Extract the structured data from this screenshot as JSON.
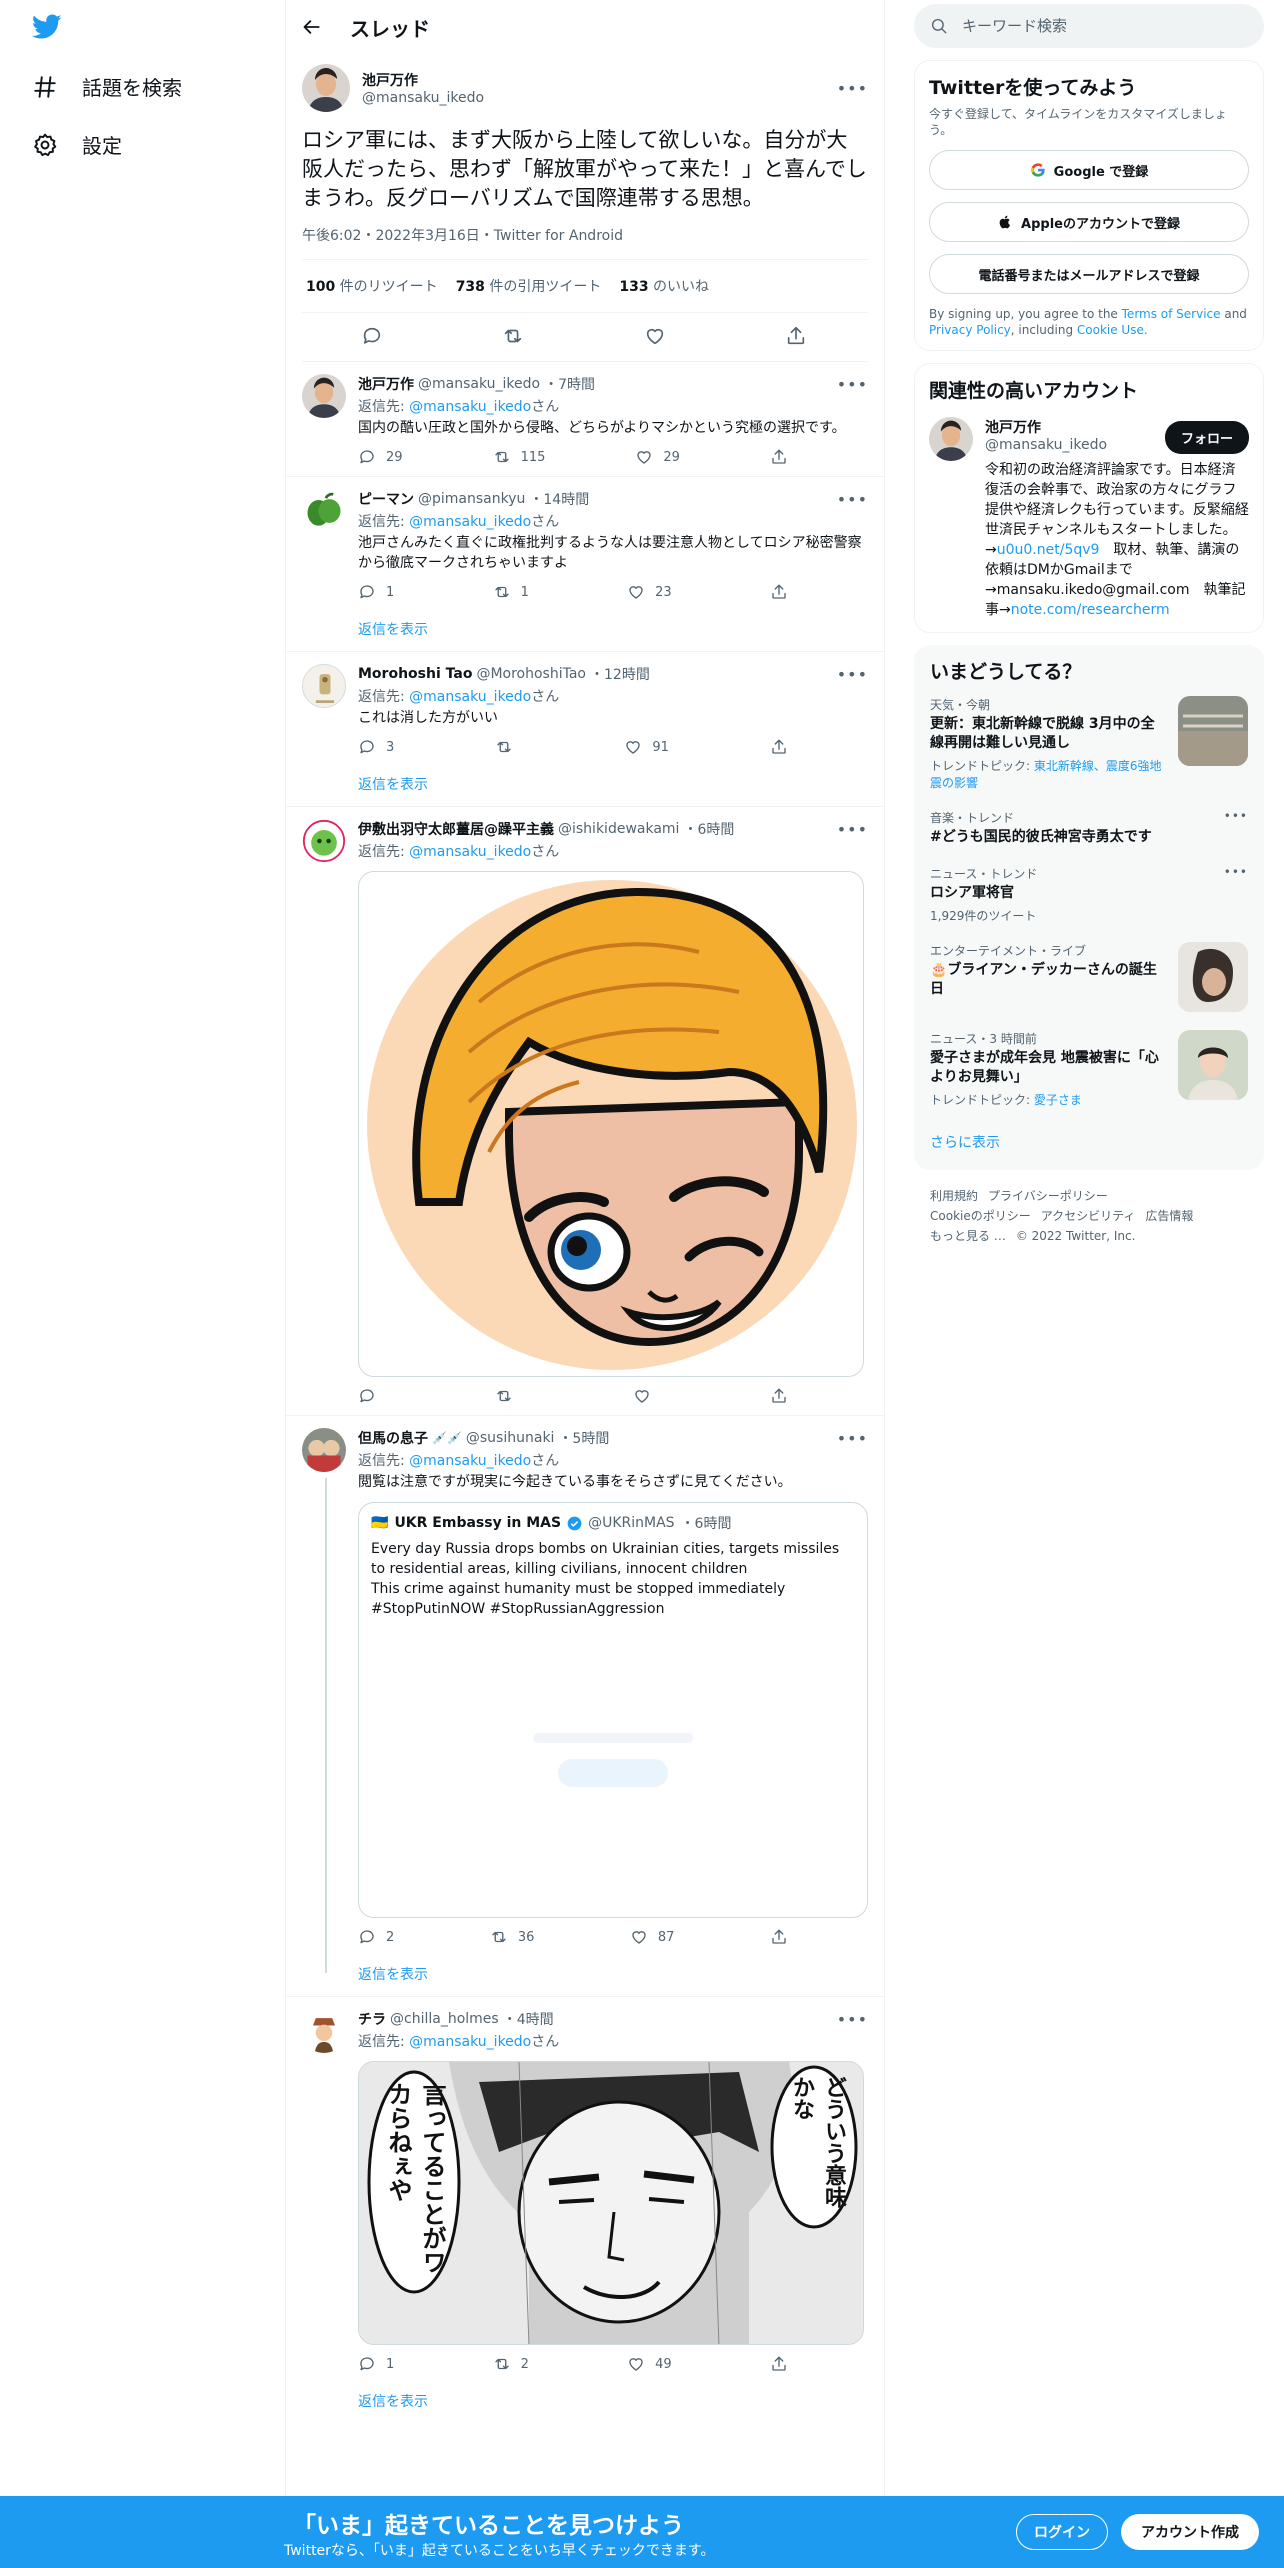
{
  "nav": {
    "explore_label": "話題を検索",
    "settings_label": "設定"
  },
  "header": {
    "title": "スレッド"
  },
  "focus_tweet": {
    "name": "池戸万作",
    "handle": "@mansaku_ikedo",
    "text": "ロシア軍には、まず大阪から上陸して欲しいな。自分が大阪人だったら、思わず「解放軍がやって来た！」と喜んでしまうわ。反グローバリズムで国際連帯する思想。",
    "meta": "午後6:02・2022年3月16日・Twitter for Android",
    "retweets_num": "100",
    "retweets_label": " 件のリツイート",
    "quotes_num": "738",
    "quotes_label": " 件の引用ツイート",
    "likes_num": "133",
    "likes_label": " のいいね"
  },
  "reply_to_prefix": "返信先: ",
  "reply_to_handle": "@mansaku_ikedo",
  "reply_to_suffix": "さん",
  "show_replies": "返信を表示",
  "replies": [
    {
      "name": "池戸万作",
      "handle": "@mansaku_ikedo",
      "time": "・7時間",
      "text": "国内の酷い圧政と国外から侵略、どちらがよりマシかという究極の選択です。",
      "replies": "29",
      "retweets": "115",
      "likes": "29"
    },
    {
      "name": "ピーマン",
      "handle": "@pimansankyu",
      "time": "・14時間",
      "text": "池戸さんみたく直ぐに政権批判するような人は要注意人物としてロシア秘密警察から徹底マークされちゃいますよ",
      "replies": "1",
      "retweets": "1",
      "likes": "23"
    },
    {
      "name": "Morohoshi Tao",
      "handle": "@MorohoshiTao",
      "time": "・12時間",
      "text": "これは消した方がいい",
      "replies": "3",
      "retweets": "",
      "likes": "91"
    },
    {
      "name": "伊敷出羽守太郎薑居@躁平主義",
      "handle": "@ishikidewakami",
      "time": "・6時間"
    },
    {
      "name": "但馬の息子",
      "name_emoji": "💉💉",
      "handle": "@susihunaki",
      "time": "・5時間",
      "text": "閲覧は注意ですが現実に今起きている事をそらさずに見てください。",
      "replies": "2",
      "retweets": "36",
      "likes": "87"
    },
    {
      "name": "チラ",
      "handle": "@chilla_holmes",
      "time": "・4時間",
      "replies": "1",
      "retweets": "2",
      "likes": "49"
    }
  ],
  "quote": {
    "flag": "🇺🇦",
    "name": "UKR Embassy in MAS",
    "handle": "@UKRinMAS",
    "time": "・6時間",
    "text1": "Every day Russia drops bombs on Ukrainian cities, targets missiles to residential areas, killing civilians, innocent children",
    "text2": "This crime against humanity must be stopped immediately",
    "text3": "#StopPutinNOW #StopRussianAggression"
  },
  "manga_text": {
    "right": "どういう意味かな",
    "left": "言ってることがワカらねぇや"
  },
  "search": {
    "placeholder": "キーワード検索"
  },
  "signup_card": {
    "title": "Twitterを使ってみよう",
    "subtitle": "今すぐ登録して、タイムラインをカスタマイズしましょう。",
    "google": "Google で登録",
    "apple": "Appleのアカウントで登録",
    "phone": "電話番号またはメールアドレスで登録",
    "terms_pre": "By signing up, you agree to the ",
    "terms_link": "Terms of Service",
    "terms_mid": " and ",
    "privacy_link": "Privacy Policy",
    "terms_cookie": ", including ",
    "cookie_link": "Cookie Use."
  },
  "related": {
    "title": "関連性の高いアカウント",
    "name": "池戸万作",
    "handle": "@mansaku_ikedo",
    "follow": "フォロー",
    "bio1": "令和初の政治経済評論家です。日本経済復活の会幹事で、政治家の方々にグラフ提供や経済レクも行っています。反緊縮経世済民チャンネルもスタートしました。→",
    "bio_link1": "u0u0.net/5qv9",
    "bio2": "　取材、執筆、講演の依頼はDMかGmailまで→mansaku.ikedo@gmail.com　執筆記事→",
    "bio_link2": "note.com/researcherm"
  },
  "trends": {
    "title": "いまどうしてる？",
    "items": [
      {
        "cat": "天気・今朝",
        "title": "更新：東北新幹線で脱線 3月中の全線再開は難しい見通し",
        "sub_pre": "トレンドトピック: ",
        "sub_link": "東北新幹線、震度6強地震の影響"
      },
      {
        "cat": "音楽・トレンド",
        "title": "#どうも国民的彼氏神宮寺勇太です"
      },
      {
        "cat": "ニュース・トレンド",
        "title": "ロシア軍将官",
        "sub": "1,929件のツイート"
      },
      {
        "cat": "エンターテイメント・ライブ",
        "title": "🎂ブライアン・デッカーさんの誕生日"
      },
      {
        "cat": "ニュース・3 時間前",
        "title": "愛子さまが成年会見 地震被害に「心よりお見舞い」",
        "sub_pre": "トレンドトピック: ",
        "sub_link": "愛子さま"
      }
    ],
    "show_more": "さらに表示"
  },
  "footer": {
    "l1": "利用規約",
    "l2": "プライバシーポリシー",
    "l3": "Cookieのポリシー",
    "l4": "アクセシビリティ",
    "l5": "広告情報",
    "l6": "もっと見る …",
    "copy": "© 2022 Twitter, Inc."
  },
  "bottom": {
    "headline": "「いま」起きていることを見つけよう",
    "sub": "Twitterなら、「いま」起きていることをいち早くチェックできます。",
    "login": "ログイン",
    "signup": "アカウント作成"
  },
  "colors": {
    "accent": "#1d9bf0",
    "text": "#0f1419",
    "muted": "#536471"
  }
}
